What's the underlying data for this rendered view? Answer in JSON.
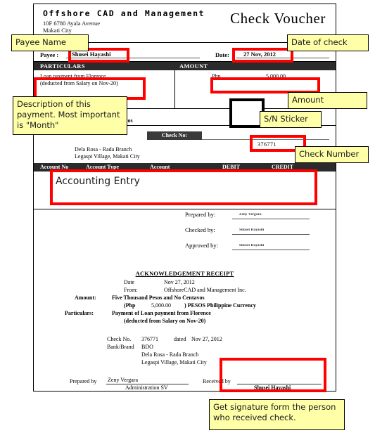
{
  "document": {
    "company_name": "Offshore CAD and Management",
    "address_line1": "10F 6780 Ayala Avenue",
    "address_line2": "Makati City",
    "title": "Check Voucher",
    "payee_label": "Payee :",
    "payee_value": "Shusei Hayashi",
    "date_label": "Date:",
    "date_value": "27 Nov, 2012",
    "particulars_header": "PARTICULARS",
    "amount_header": "AMOUNT",
    "particulars_line1": "Loan payment from Florence",
    "particulars_line2": "(deducted from Salary on Nov-20)",
    "amount_currency": "Php",
    "amount_value": "5,000.00",
    "amount_in_words": "Five Thousand Pesos and No Centavos",
    "check_no_label": "Check No:",
    "check_no_value": "376771",
    "bank_branch_line1": "Dela Rosa - Rada Branch",
    "bank_branch_line2": "Legaspi Village, Makati City",
    "account_columns": [
      "Account No",
      "Account Type",
      "Account",
      "DEBIT",
      "CREDIT"
    ],
    "approvals": [
      {
        "label": "Prepared by:",
        "signature": "Zeny Vergara"
      },
      {
        "label": "Checked by:",
        "signature": "Shusei Hayashi"
      },
      {
        "label": "Approved by:",
        "signature": "Shusei Hayashi"
      }
    ]
  },
  "acknowledgement": {
    "title": "ACKNOWLEDGEMENT RECEIPT",
    "date_label": "Date",
    "date_value": "Nov 27, 2012",
    "from_label": "From:",
    "from_value": "OffshoreCAD and Management Inc.",
    "amount_label": "Amount:",
    "amount_words": "Five Thousand Pesos and No Centavos",
    "amount_paren_open": "(Php",
    "amount_figure": "5,000.00",
    "amount_paren_close": ") PESOS Philippine Currency",
    "particulars_label": "Particulars:",
    "particulars_value": "Payment of   Loan payment from Florence",
    "particulars_value2": "(deducted from Salary on Nov-20)",
    "check_no_label": "Check No.",
    "check_no_value": "376771",
    "dated_label": "dated",
    "dated_value": "Nov 27, 2012",
    "bank_brand_label": "Bank/Brand",
    "bank_brand_value": "BDO",
    "bank_line1": "Dela Rosa - Rada Branch",
    "bank_line2": "Legaspi Village, Makati City",
    "prepared_by_label": "Prepared by",
    "prepared_by_name": "Zeny Vergara",
    "prepared_by_title": "Administration SV",
    "received_by_label": "Received by",
    "received_by_name": "Shusei Hayashi"
  },
  "annotations": [
    {
      "id": "payee-name",
      "text": "Payee Name"
    },
    {
      "id": "date-of-check",
      "text": "Date of check"
    },
    {
      "id": "description",
      "text": "Description of this payment. Most important is \"Month\""
    },
    {
      "id": "amount",
      "text": "Amount"
    },
    {
      "id": "sn-sticker",
      "text": "S/N Sticker"
    },
    {
      "id": "check-number",
      "text": "Check Number"
    },
    {
      "id": "accounting-entry",
      "text": "Accounting Entry"
    },
    {
      "id": "get-signature",
      "text": "Get signature form the person who received check."
    }
  ],
  "colors": {
    "highlight_red": "#ff0000",
    "note_yellow": "#ffffa8",
    "bar_dark": "#2b2b2b"
  }
}
